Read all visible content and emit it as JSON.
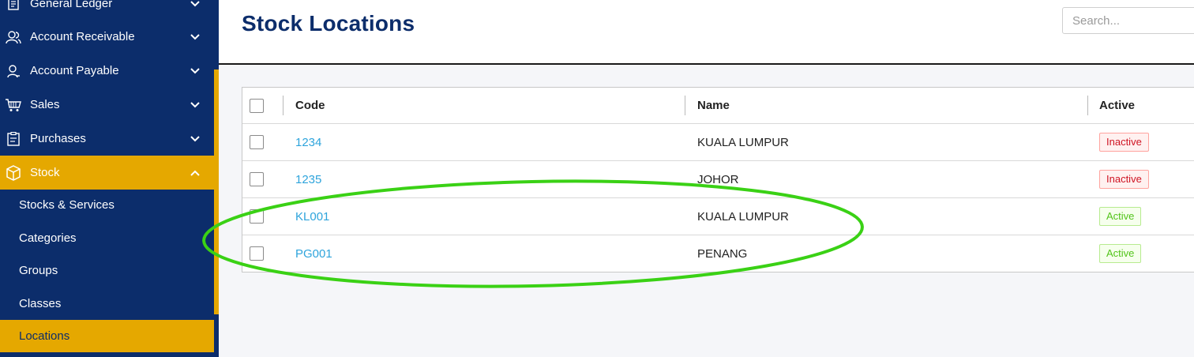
{
  "sidebar": {
    "items": [
      {
        "label": "General Ledger",
        "icon": "ledger-icon"
      },
      {
        "label": "Account Receivable",
        "icon": "users-icon"
      },
      {
        "label": "Account Payable",
        "icon": "user-icon"
      },
      {
        "label": "Sales",
        "icon": "cart-icon"
      },
      {
        "label": "Purchases",
        "icon": "clipboard-icon"
      },
      {
        "label": "Stock",
        "icon": "box-icon"
      }
    ],
    "sub_items": [
      {
        "label": "Stocks & Services"
      },
      {
        "label": "Categories"
      },
      {
        "label": "Groups"
      },
      {
        "label": "Classes"
      },
      {
        "label": "Locations"
      }
    ]
  },
  "header": {
    "title": "Stock Locations",
    "search_placeholder": "Search..."
  },
  "table": {
    "columns": [
      "Code",
      "Name",
      "Active"
    ],
    "rows": [
      {
        "code": "1234",
        "name": "KUALA LUMPUR",
        "status": "Inactive"
      },
      {
        "code": "1235",
        "name": "JOHOR",
        "status": "Inactive"
      },
      {
        "code": "KL001",
        "name": "KUALA LUMPUR",
        "status": "Active"
      },
      {
        "code": "PG001",
        "name": "PENANG",
        "status": "Active"
      }
    ]
  },
  "colors": {
    "sidebar_bg": "#0c2d6b",
    "accent": "#e5a800",
    "link": "#2ea4dc",
    "annotation": "#3ad115"
  }
}
